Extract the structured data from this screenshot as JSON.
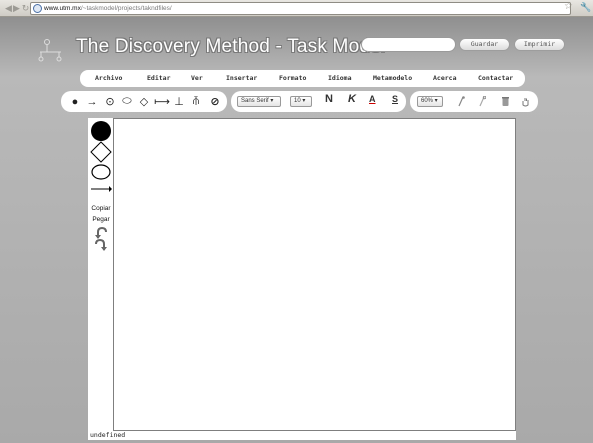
{
  "browser": {
    "url_host": "www.utm.mx",
    "url_path": "/~taskmodel/projects/takndfiles/",
    "back_icon": "arrow-left-icon",
    "forward_icon": "arrow-right-icon",
    "reload_icon": "reload-icon",
    "bookmark_icon": "star-icon",
    "tools_icon": "wrench-icon"
  },
  "header": {
    "title": "The Discovery Method - Task Model",
    "name_input_value": "",
    "save_label": "Guardar",
    "print_label": "Imprimir"
  },
  "menu": {
    "items": [
      "Archivo",
      "Editar",
      "Ver",
      "Insertar",
      "Formato",
      "Idioma",
      "Metamodelo",
      "Acerca",
      "Contactar"
    ]
  },
  "toolbar": {
    "shapes": [
      "●",
      "→",
      "⊙",
      "⬭",
      "◇",
      "⟼",
      "⊥",
      "⫚",
      "⊘"
    ],
    "font_family": "Sans Serif",
    "font_size": "10",
    "bold_label": "N",
    "italic_label": "K",
    "color_label": "A",
    "underline_label": "S",
    "zoom": "60%"
  },
  "palette": {
    "copy_label": "Copiar",
    "paste_label": "Pegar"
  },
  "status_text": "undefined"
}
